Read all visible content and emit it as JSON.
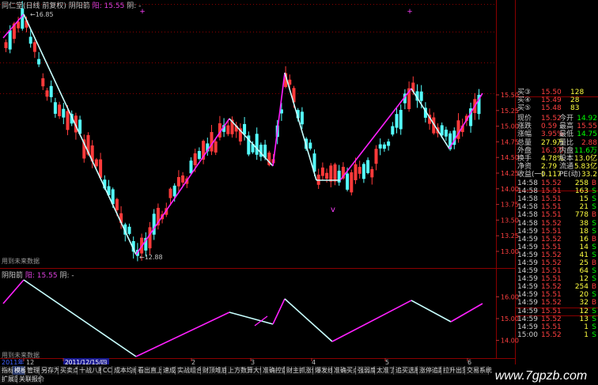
{
  "title": {
    "stock": "同仁堂(日线 前复权)",
    "indicator": "阴阳箭",
    "value_label": "阳: 15.55",
    "value_label2": "阴: -"
  },
  "sub_title": {
    "indicator": "阴阳箭",
    "value_label": "阳: 15.55",
    "value_label2": "阴: -"
  },
  "main_labels": {
    "high_mark": "16.85",
    "low_mark": "12.88",
    "future_label": "用到未来数据",
    "v_mark": "v"
  },
  "sub_labels": {
    "future_label": "用到未来数据"
  },
  "main_axis": [
    "15.50",
    "15.25",
    "15.00",
    "14.75",
    "14.50",
    "14.25",
    "14.00",
    "13.75",
    "13.50",
    "13.25",
    "13.00"
  ],
  "sub_axis": [
    "16.00",
    "15.00",
    "14.00"
  ],
  "date_axis": {
    "year": "2011年",
    "m12": "12",
    "date_box": "2011/12/15/四",
    "m2": "2",
    "m3": "3",
    "m4": "4",
    "m5": "5",
    "m6": "6"
  },
  "quote": {
    "asks": [
      {
        "label": "买③",
        "price": "15.50",
        "vol": "128"
      },
      {
        "label": "买④",
        "price": "15.49",
        "vol": "28"
      },
      {
        "label": "买⑤",
        "price": "15.48",
        "vol": "83"
      }
    ],
    "stats": [
      {
        "l1": "现价",
        "v1": "15.52",
        "l2": "今开",
        "v2": "14.92"
      },
      {
        "l1": "涨跌",
        "v1": "0.59",
        "l2": "最高",
        "v2": "15.55"
      },
      {
        "l1": "涨幅",
        "v1": "3.95%",
        "l2": "最低",
        "v2": "14.75"
      },
      {
        "l1": "总量",
        "v1": "27.9万",
        "l2": "量比",
        "v2": "2.88"
      },
      {
        "l1": "外盘",
        "v1": "16.3万",
        "l2": "内盘",
        "v2": "11.6万"
      },
      {
        "l1": "换手",
        "v1": "4.78%",
        "l2": "股本",
        "v2": "13.0亿"
      },
      {
        "l1": "净资",
        "v1": "2.79",
        "l2": "流通",
        "v2": "5.83亿"
      },
      {
        "l1": "收益(一)",
        "v1": "0.117",
        "l2": "PE(动)",
        "v2": "33.2"
      }
    ]
  },
  "ticks": [
    {
      "t": "14:58",
      "p": "15.52",
      "v": "258",
      "s": "B"
    },
    {
      "t": "14:58",
      "p": "15.51",
      "v": "163",
      "s": "S"
    },
    {
      "t": "14:58",
      "p": "15.51",
      "v": "15",
      "s": "S"
    },
    {
      "t": "14:58",
      "p": "15.51",
      "v": "21",
      "s": "S"
    },
    {
      "t": "14:58",
      "p": "15.51",
      "v": "778",
      "s": "B"
    },
    {
      "t": "14:58",
      "p": "15.52",
      "v": "38",
      "s": "S"
    },
    {
      "t": "14:59",
      "p": "15.51",
      "v": "18",
      "s": "S"
    },
    {
      "t": "14:59",
      "p": "15.52",
      "v": "16",
      "s": "B"
    },
    {
      "t": "14:59",
      "p": "15.51",
      "v": "14",
      "s": "S"
    },
    {
      "t": "14:59",
      "p": "15.52",
      "v": "41",
      "s": "S"
    },
    {
      "t": "14:59",
      "p": "15.52",
      "v": "25",
      "s": "B"
    },
    {
      "t": "14:59",
      "p": "15.51",
      "v": "64",
      "s": "S"
    },
    {
      "t": "14:59",
      "p": "15.51",
      "v": "12",
      "s": "S"
    },
    {
      "t": "14:59",
      "p": "15.52",
      "v": "254",
      "s": "B"
    },
    {
      "t": "14:59",
      "p": "15.51",
      "v": "20",
      "s": "S"
    },
    {
      "t": "14:59",
      "p": "15.52",
      "v": "32",
      "s": "B"
    },
    {
      "t": "14:59",
      "p": "15.51",
      "v": "12",
      "s": "S"
    },
    {
      "t": "14:59",
      "p": "15.52",
      "v": "13",
      "s": "S"
    },
    {
      "t": "14:59",
      "p": "15.51",
      "v": "1",
      "s": "S"
    },
    {
      "t": "15:00",
      "p": "15.52",
      "v": "1",
      "s": "S"
    }
  ],
  "toolbar": {
    "row1": [
      "指标",
      "模板",
      "管理",
      "另存为",
      "买卖点",
      "十战八胜",
      "CCI",
      "成本均线",
      "看出直上",
      "速成",
      "实战组合",
      "财顶堆底",
      "上方数算大90",
      "准确控盘",
      "财主抓涨停",
      "爆发线",
      "准确买点",
      "强弱度",
      "太准了",
      "追买选股",
      "涨停追踪",
      "拉升出货",
      "交易系统"
    ],
    "row2": [
      "扩展区",
      "关联报价"
    ]
  },
  "watermark": "www.7gpzb.com",
  "colors": {
    "up": "#ff3a3a",
    "down": "#54ffff",
    "zig_up": "#ff20ff",
    "zig_down": "#c8ffff",
    "grid": "#8a0000"
  }
}
